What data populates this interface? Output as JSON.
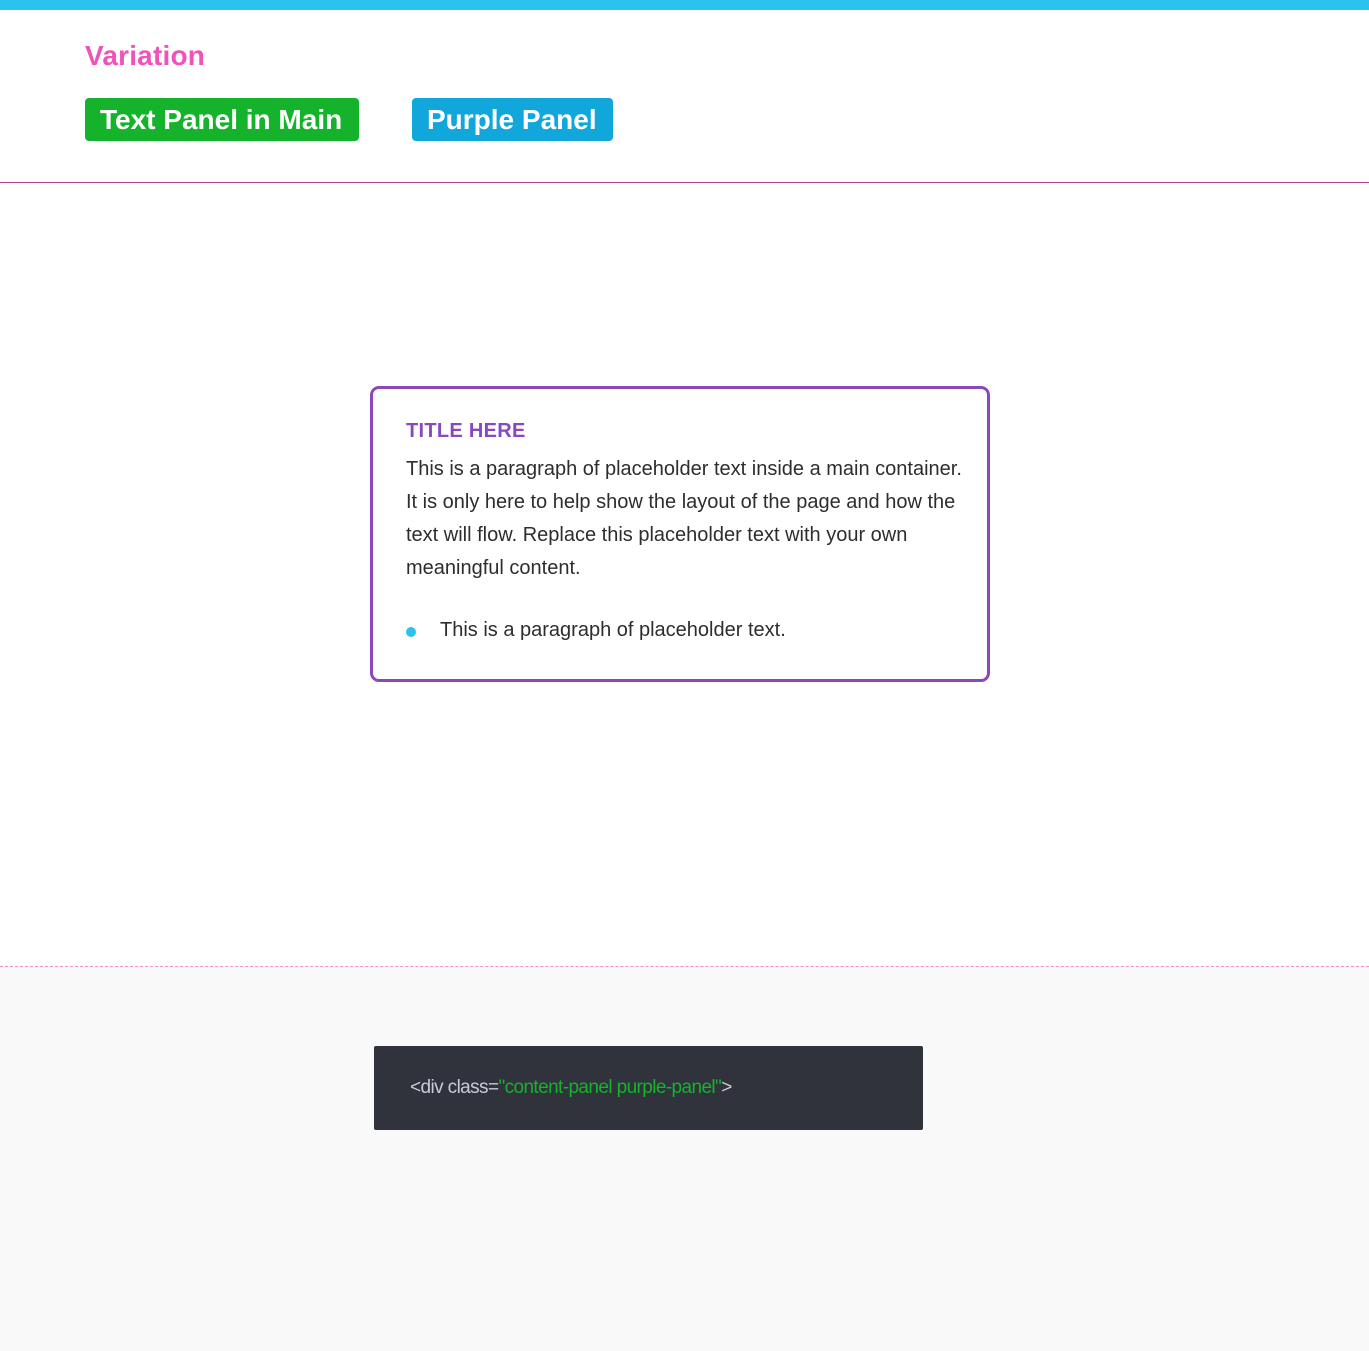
{
  "header": {
    "variation_label": "Variation",
    "tags": [
      {
        "label": "Text Panel in Main",
        "color": "#15b32c"
      },
      {
        "label": "Purple Panel",
        "color": "#11a7db"
      }
    ]
  },
  "panel": {
    "title": "TITLE HERE",
    "body": "This is a paragraph of placeholder text inside a main container. It is only here to help show the layout of the page and how the text will flow. Replace this placeholder text with your own meaningful content.",
    "list_items": [
      "This is a paragraph of placeholder text."
    ],
    "border_color": "#8b48bd"
  },
  "code": {
    "prefix": "<div class=",
    "string": "\"content-panel purple-panel\"",
    "suffix": ">"
  },
  "colors": {
    "accent_bar": "#29c3ec",
    "variation_pink": "#f052b9",
    "code_background": "#30323c"
  }
}
